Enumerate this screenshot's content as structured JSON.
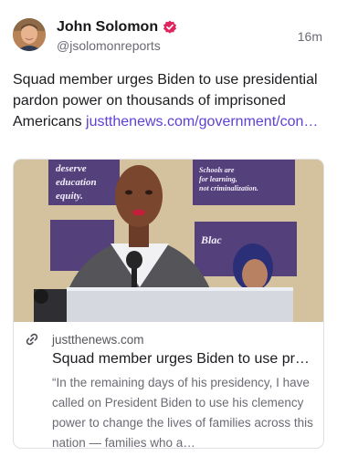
{
  "post": {
    "author": {
      "display_name": "John Solomon",
      "handle": "@jsolomonreports",
      "verified_icon": "verified-badge-icon",
      "avatar_icon": "avatar"
    },
    "timestamp": "16m",
    "text": "Squad member urges Biden to use presidential pardon power on thousands of imprisoned Americans ",
    "link_text": "justthenews.com/​government/con…",
    "link_preview": {
      "domain": "justthenews.com",
      "title": "Squad member urges Biden to use pr…",
      "description": "“In the remaining days of his presidency, I have called on President Biden to use his clemency power to change the lives of families across this nation — families who a…",
      "image_signs": {
        "sign1": "deserve education equity.",
        "sign2": "Schools are for learning, not criminalization.",
        "sign3": "Blac…"
      }
    }
  },
  "colors": {
    "accent": "#5f3fd4",
    "verified": "#e0245e",
    "text": "#1b1b1f",
    "muted": "#6a6a73"
  }
}
